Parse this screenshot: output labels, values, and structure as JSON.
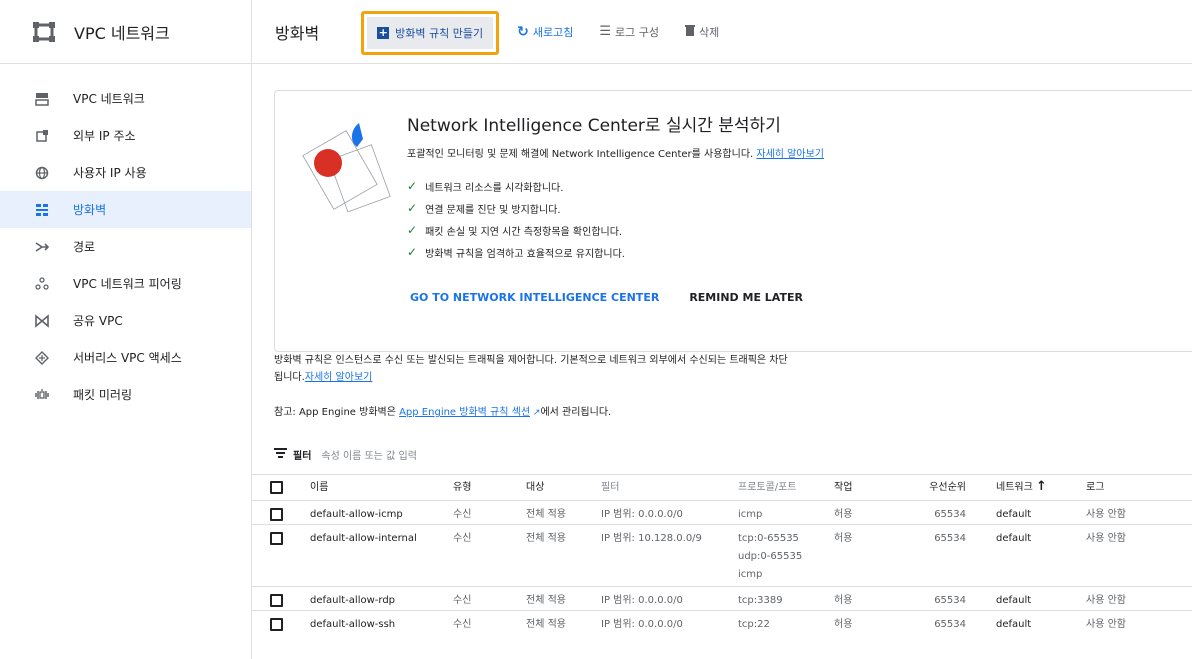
{
  "sidebar": {
    "title": "VPC 네트워크",
    "items": [
      {
        "label": "VPC 네트워크",
        "icon": "vpc-network-icon"
      },
      {
        "label": "외부 IP 주소",
        "icon": "external-ip-icon"
      },
      {
        "label": "사용자 IP 사용",
        "icon": "byoip-globe-icon"
      },
      {
        "label": "방화벽",
        "icon": "firewall-icon"
      },
      {
        "label": "경로",
        "icon": "routes-icon"
      },
      {
        "label": "VPC 네트워크 피어링",
        "icon": "peering-icon"
      },
      {
        "label": "공유 VPC",
        "icon": "shared-vpc-icon"
      },
      {
        "label": "서버리스 VPC 액세스",
        "icon": "serverless-icon"
      },
      {
        "label": "패킷 미러링",
        "icon": "packet-mirroring-icon"
      }
    ]
  },
  "toolbar": {
    "title": "방화벽",
    "create_label": "방화벽 규칙 만들기",
    "refresh_label": "새로고침",
    "logs_label": "로그 구성",
    "delete_label": "삭제"
  },
  "banner": {
    "title": "Network Intelligence Center로 실시간 분석하기",
    "subtitle": "포괄적인 모니터링 및 문제 해결에 Network Intelligence Center를 사용합니다.",
    "learn_more": "자세히 알아보기",
    "checks": [
      "네트워크 리소스를 시각화합니다.",
      "연결 문제를 진단 및 방지합니다.",
      "패킷 손실 및 지연 시간 측정항목을 확인합니다.",
      "방화벽 규칙을 엄격하고 효율적으로 유지합니다."
    ],
    "go_label": "GO TO NETWORK INTELLIGENCE CENTER",
    "later_label": "REMIND ME LATER"
  },
  "description": {
    "text": "방화벽 규칙은 인스턴스로 수신 또는 발신되는 트래픽을 제어합니다. 기본적으로 네트워크 외부에서 수신되는 트래픽은 차단됩니다.",
    "learn_more": "자세히 알아보기"
  },
  "note": {
    "prefix": "참고: App Engine 방화벽은 ",
    "link": "App Engine 방화벽 규칙 섹션",
    "suffix": "에서 관리됩니다."
  },
  "filter": {
    "label": "필터",
    "placeholder": "속성 이름 또는 값 입력"
  },
  "table": {
    "columns": {
      "name": "이름",
      "type": "유형",
      "target": "대상",
      "filter": "필터",
      "proto": "프로토콜/포트",
      "action": "작업",
      "priority": "우선순위",
      "network": "네트워크",
      "log": "로그"
    },
    "rows": [
      {
        "name": "default-allow-icmp",
        "type": "수신",
        "target": "전체 적용",
        "filter": "IP 범위: 0.0.0.0/0",
        "proto": [
          "icmp"
        ],
        "action": "허용",
        "priority": "65534",
        "network": "default",
        "log": "사용 안함"
      },
      {
        "name": "default-allow-internal",
        "type": "수신",
        "target": "전체 적용",
        "filter": "IP 범위: 10.128.0.0/9",
        "proto": [
          "tcp:0-65535",
          "udp:0-65535",
          "icmp"
        ],
        "action": "허용",
        "priority": "65534",
        "network": "default",
        "log": "사용 안함"
      },
      {
        "name": "default-allow-rdp",
        "type": "수신",
        "target": "전체 적용",
        "filter": "IP 범위: 0.0.0.0/0",
        "proto": [
          "tcp:3389"
        ],
        "action": "허용",
        "priority": "65534",
        "network": "default",
        "log": "사용 안함"
      },
      {
        "name": "default-allow-ssh",
        "type": "수신",
        "target": "전체 적용",
        "filter": "IP 범위: 0.0.0.0/0",
        "proto": [
          "tcp:22"
        ],
        "action": "허용",
        "priority": "65534",
        "network": "default",
        "log": "사용 안함"
      }
    ]
  }
}
